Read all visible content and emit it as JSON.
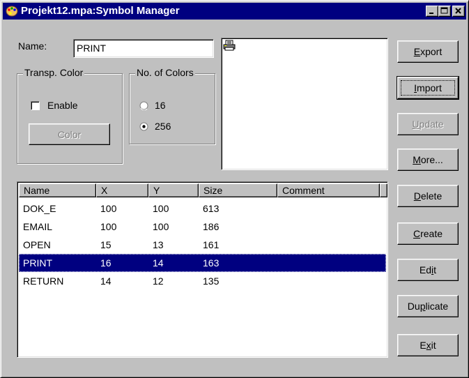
{
  "window": {
    "title": "Projekt12.mpa:Symbol Manager",
    "controls": [
      "minimize-icon",
      "maximize-icon",
      "close-icon"
    ]
  },
  "name_field": {
    "label": "Name:",
    "value": "PRINT"
  },
  "transp_color": {
    "legend": "Transp. Color",
    "enable_label": "Enable",
    "enable_checked": false,
    "color_button": "Color"
  },
  "num_colors": {
    "legend": "No. of Colors",
    "options": [
      {
        "label": "16",
        "selected": false
      },
      {
        "label": "256",
        "selected": true
      }
    ]
  },
  "preview": {
    "icon": "printer-icon"
  },
  "buttons": {
    "export": {
      "pre": "",
      "key": "E",
      "post": "xport"
    },
    "import": {
      "pre": "",
      "key": "I",
      "post": "mport"
    },
    "update": {
      "pre": "",
      "key": "U",
      "post": "pdate"
    },
    "more": {
      "pre": "",
      "key": "M",
      "post": "ore..."
    },
    "delete": {
      "pre": "",
      "key": "D",
      "post": "elete"
    },
    "create": {
      "pre": "",
      "key": "C",
      "post": "reate"
    },
    "edit": {
      "pre": "Ed",
      "key": "i",
      "post": "t"
    },
    "duplicate": {
      "pre": "Du",
      "key": "p",
      "post": "licate"
    },
    "exit": {
      "pre": "E",
      "key": "x",
      "post": "it"
    }
  },
  "table": {
    "columns": [
      "Name",
      "X",
      "Y",
      "Size",
      "Comment"
    ],
    "rows": [
      {
        "name": "DOK_E",
        "x": "100",
        "y": "100",
        "size": "613",
        "comment": ""
      },
      {
        "name": "EMAIL",
        "x": "100",
        "y": "100",
        "size": "186",
        "comment": ""
      },
      {
        "name": "OPEN",
        "x": "15",
        "y": "13",
        "size": "161",
        "comment": ""
      },
      {
        "name": "PRINT",
        "x": "16",
        "y": "14",
        "size": "163",
        "comment": ""
      },
      {
        "name": "RETURN",
        "x": "14",
        "y": "12",
        "size": "135",
        "comment": ""
      }
    ],
    "selected_row": 3
  },
  "colors": {
    "titlebar": "#000080",
    "selection": "#000080",
    "face": "#c0c0c0"
  }
}
